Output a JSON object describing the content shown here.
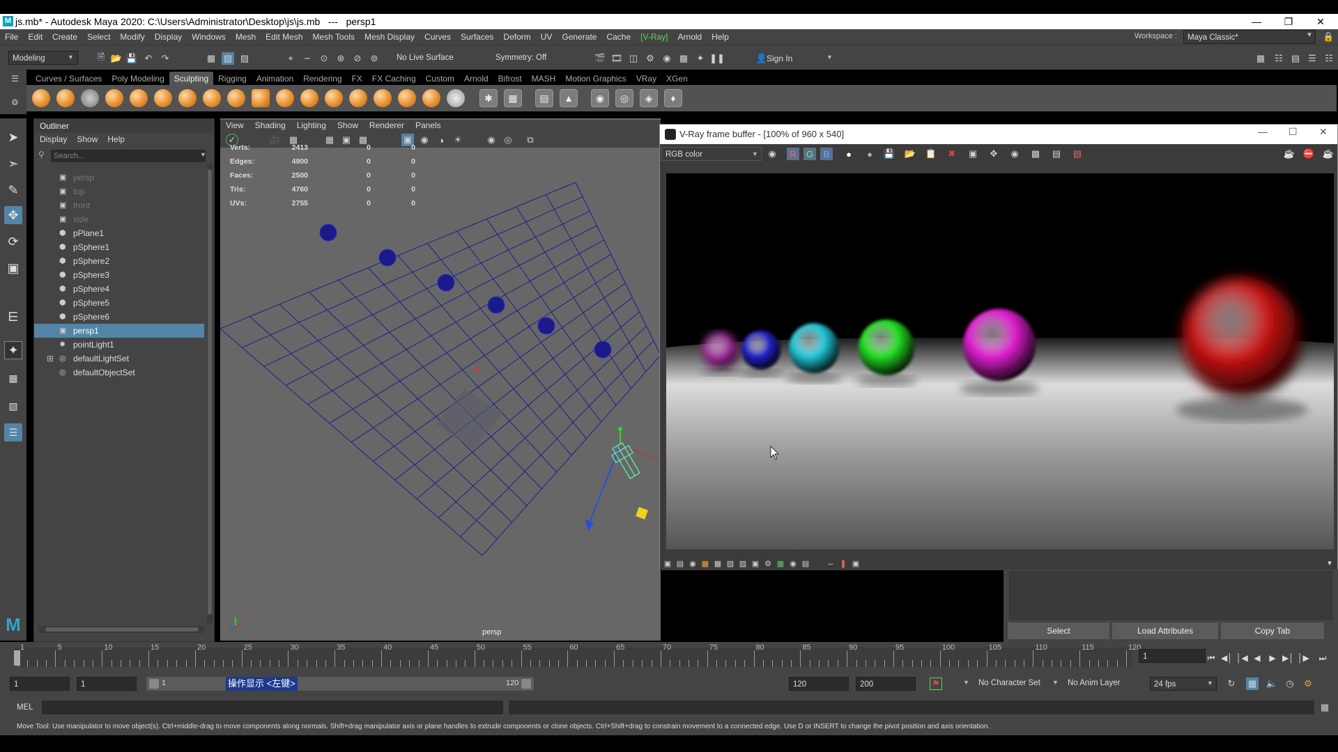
{
  "window": {
    "title": "js.mb* - Autodesk Maya 2020: C:\\Users\\Administrator\\Desktop\\js\\js.mb   ---   persp1",
    "app_icon": "M"
  },
  "menubar": [
    "File",
    "Edit",
    "Create",
    "Select",
    "Modify",
    "Display",
    "Windows",
    "Mesh",
    "Edit Mesh",
    "Mesh Tools",
    "Mesh Display",
    "Curves",
    "Surfaces",
    "Deform",
    "UV",
    "Generate",
    "Cache",
    "[V-Ray]",
    "Arnold",
    "Help"
  ],
  "workspace": {
    "label": "Workspace :",
    "value": "Maya Classic*"
  },
  "statusline": {
    "menuset": "Modeling",
    "live_surface": "No Live Surface",
    "symmetry": "Symmetry: Off",
    "signin": "Sign In"
  },
  "shelf": {
    "tabs": [
      "Curves / Surfaces",
      "Poly Modeling",
      "Sculpting",
      "Rigging",
      "Animation",
      "Rendering",
      "FX",
      "FX Caching",
      "Custom",
      "Arnold",
      "Bifrost",
      "MASH",
      "Motion Graphics",
      "VRay",
      "XGen"
    ],
    "active_tab": "Sculpting"
  },
  "outliner": {
    "title": "Outliner",
    "menu": [
      "Display",
      "Show",
      "Help"
    ],
    "search_placeholder": "Search...",
    "items": [
      {
        "label": "persp",
        "icon": "camera-icon",
        "dim": true
      },
      {
        "label": "top",
        "icon": "camera-icon",
        "dim": true
      },
      {
        "label": "front",
        "icon": "camera-icon",
        "dim": true
      },
      {
        "label": "side",
        "icon": "camera-icon",
        "dim": true
      },
      {
        "label": "pPlane1",
        "icon": "mesh-icon"
      },
      {
        "label": "pSphere1",
        "icon": "mesh-icon"
      },
      {
        "label": "pSphere2",
        "icon": "mesh-icon"
      },
      {
        "label": "pSphere3",
        "icon": "mesh-icon"
      },
      {
        "label": "pSphere4",
        "icon": "mesh-icon"
      },
      {
        "label": "pSphere5",
        "icon": "mesh-icon"
      },
      {
        "label": "pSphere6",
        "icon": "mesh-icon"
      },
      {
        "label": "persp1",
        "icon": "camera-icon",
        "selected": true
      },
      {
        "label": "pointLight1",
        "icon": "light-icon"
      },
      {
        "label": "defaultLightSet",
        "icon": "set-icon",
        "expandable": true
      },
      {
        "label": "defaultObjectSet",
        "icon": "set-icon"
      }
    ]
  },
  "viewport": {
    "menu": [
      "View",
      "Shading",
      "Lighting",
      "Show",
      "Renderer",
      "Panels"
    ],
    "hud": [
      {
        "label": "Verts:",
        "v1": "2413",
        "v2": "0",
        "v3": "0"
      },
      {
        "label": "Edges:",
        "v1": "4900",
        "v2": "0",
        "v3": "0"
      },
      {
        "label": "Faces:",
        "v1": "2500",
        "v2": "0",
        "v3": "0"
      },
      {
        "label": "Tris:",
        "v1": "4760",
        "v2": "0",
        "v3": "0"
      },
      {
        "label": "UVs:",
        "v1": "2755",
        "v2": "0",
        "v3": "0"
      }
    ],
    "camera_label": "persp"
  },
  "vfb": {
    "title": "V-Ray frame buffer - [100% of 960 x 540]",
    "channel": "RGB color",
    "channel_buttons": [
      "R",
      "G",
      "B"
    ],
    "sphere_colors": [
      "#b01fa8",
      "#2222c8",
      "#22c8d8",
      "#22e022",
      "#e020d0",
      "#d01010"
    ]
  },
  "attribute_editor": {
    "buttons": [
      "Select",
      "Load Attributes",
      "Copy Tab"
    ]
  },
  "timeline": {
    "labels": [
      "1",
      "5",
      "10",
      "15",
      "20",
      "25",
      "30",
      "35",
      "40",
      "45",
      "50",
      "55",
      "60",
      "65",
      "70",
      "75",
      "80",
      "85",
      "90",
      "95",
      "100",
      "105",
      "110",
      "115",
      "120"
    ],
    "current_frame": "1"
  },
  "range": {
    "start": "1",
    "anim_start": "1",
    "slider_start": "1",
    "slider_end": "120",
    "end": "120",
    "anim_end": "200",
    "ime_text": "操作显示 <左键>",
    "character_set": "No Character Set",
    "anim_layer": "No Anim Layer",
    "fps": "24 fps"
  },
  "cmdline": {
    "label": "MEL"
  },
  "helpline": "Move Tool: Use manipulator to move object(s). Ctrl+middle-drag to move components along normals. Shift+drag manipulator axis or plane handles to extrude components or clone objects. Ctrl+Shift+drag to constrain movement to a connected edge. Use D or INSERT to change the pivot position and axis orientation."
}
